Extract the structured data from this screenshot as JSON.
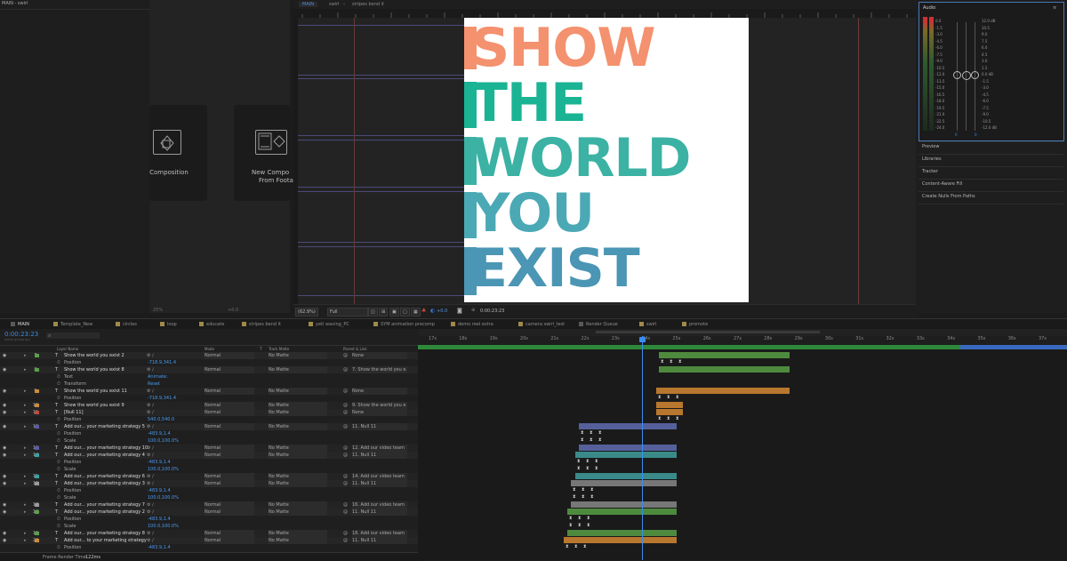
{
  "project": {
    "title": "MAIN - swirl"
  },
  "start_tiles": [
    {
      "label": "Composition"
    },
    {
      "label_line1": "New Compo",
      "label_line2": "From Foota"
    }
  ],
  "viewer": {
    "tabs": [
      "MAIN",
      "swirl",
      "stripes bend it"
    ],
    "words": [
      "SHOW",
      "THE",
      "WORLD",
      "YOU",
      "EXIST"
    ],
    "word_colors": [
      "#f4916e",
      "#1ab394",
      "#3bb2a4",
      "#4aa9b4",
      "#4a96b4"
    ],
    "zoom": "(62.9%)",
    "resolution": "Full",
    "exposure": "+0.0",
    "timecode": "0:00:23:23",
    "left_zoom": "25%",
    "left_exposure": "+0.0"
  },
  "right_panel": {
    "audio_title": "Audio",
    "db_left": [
      "0.0",
      "-1.5",
      "-3.0",
      "-4.5",
      "-6.0",
      "-7.5",
      "-9.0",
      "-10.5",
      "-12.0",
      "-13.5",
      "-15.0",
      "-16.5",
      "-18.0",
      "-19.5",
      "-21.0",
      "-22.5",
      "-24.0"
    ],
    "db_right": [
      "12.0 dB",
      "10.5",
      "9.0",
      "7.5",
      "6.0",
      "4.5",
      "3.0",
      "1.5",
      "0.0 dB",
      "-1.5",
      "-3.0",
      "-4.5",
      "-6.0",
      "-7.5",
      "-9.0",
      "-10.5",
      "-12.0 dB"
    ],
    "fader_values": [
      "0",
      "0"
    ],
    "items": [
      "Preview",
      "Libraries",
      "Tracker",
      "Content-Aware Fill",
      "Create Nulls From Paths"
    ]
  },
  "timeline": {
    "tabs": [
      "MAIN",
      "Template_New",
      "circles",
      "loop",
      "educate",
      "stripes bend it",
      "yeti waving_PC",
      "SYM animation precomp",
      "demo reel extra",
      "camera swirl_test",
      "Render Queue",
      "swirl",
      "promote"
    ],
    "timecode": "0:00:23:23",
    "timecode_sub": "00575 (23.976 fps)",
    "headers": {
      "layer_name": "Layer Name",
      "mode": "Mode",
      "t": "T",
      "track_matte": "Track Matte",
      "parent": "Parent & Link"
    },
    "ticks": [
      "17s",
      "18s",
      "19s",
      "20s",
      "21s",
      "22s",
      "23s",
      "24s",
      "25s",
      "26s",
      "27s",
      "28s",
      "29s",
      "30s",
      "31s",
      "32s",
      "33s",
      "34s",
      "35s",
      "36s",
      "37s"
    ],
    "layers": [
      {
        "num": "7",
        "name": "Show the world you exist 2",
        "mode": "Normal",
        "matte": "No Matte",
        "parent": "None",
        "color": "#5aa04a"
      },
      {
        "prop": "Position",
        "value": "-718.9,341.4"
      },
      {
        "num": "8",
        "name": "Show the world you exist 8",
        "mode": "Normal",
        "matte": "No Matte",
        "parent": "7. Show the world you e",
        "color": "#5aa04a"
      },
      {
        "prop": "Text",
        "value": "Animate:"
      },
      {
        "prop": "Transform",
        "value": "Reset"
      },
      {
        "num": "9",
        "name": "Show the world you exist 11",
        "mode": "Normal",
        "matte": "No Matte",
        "parent": "None",
        "color": "#d08a3a"
      },
      {
        "prop": "Position",
        "value": "-718.9,341.4"
      },
      {
        "num": "10",
        "name": "Show the world you exist 9",
        "mode": "Normal",
        "matte": "No Matte",
        "parent": "9. Show the world you e",
        "color": "#d08a3a"
      },
      {
        "num": "11",
        "name": "[Null 11]",
        "mode": "Normal",
        "matte": "No Matte",
        "parent": "None",
        "color": "#c04a3a"
      },
      {
        "prop": "Position",
        "value": "540.0,540.0"
      },
      {
        "num": "12",
        "name": "Add our... your marketing strategy 5",
        "mode": "Normal",
        "matte": "No Matte",
        "parent": "11. Null 11",
        "color": "#5a5aa8"
      },
      {
        "prop": "Position",
        "value": "-483.9,1.4"
      },
      {
        "prop": "Scale",
        "value": "100.0,100.0%"
      },
      {
        "num": "13",
        "name": "Add our... your marketing strategy 10",
        "mode": "Normal",
        "matte": "No Matte",
        "parent": "12. Add our video team",
        "color": "#5a5aa8"
      },
      {
        "num": "14",
        "name": "Add our... your marketing strategy 4",
        "mode": "Normal",
        "matte": "No Matte",
        "parent": "11. Null 11",
        "color": "#3aa0a0"
      },
      {
        "prop": "Position",
        "value": "-483.9,1.4"
      },
      {
        "prop": "Scale",
        "value": "100.0,100.0%"
      },
      {
        "num": "15",
        "name": "Add our... your marketing strategy 6",
        "mode": "Normal",
        "matte": "No Matte",
        "parent": "14. Add our video team",
        "color": "#3aa0a0"
      },
      {
        "num": "16",
        "name": "Add our... your marketing strategy 3",
        "mode": "Normal",
        "matte": "No Matte",
        "parent": "11. Null 11",
        "color": "#9a9a9a"
      },
      {
        "prop": "Position",
        "value": "-483.9,1.4"
      },
      {
        "prop": "Scale",
        "value": "100.0,100.0%"
      },
      {
        "num": "17",
        "name": "Add our... your marketing strategy 7",
        "mode": "Normal",
        "matte": "No Matte",
        "parent": "16. Add our video team",
        "color": "#9a9a9a"
      },
      {
        "num": "18",
        "name": "Add our... your marketing strategy 2",
        "mode": "Normal",
        "matte": "No Matte",
        "parent": "11. Null 11",
        "color": "#5aa04a"
      },
      {
        "prop": "Position",
        "value": "-483.9,1.4"
      },
      {
        "prop": "Scale",
        "value": "100.0,100.0%"
      },
      {
        "num": "19",
        "name": "Add our... your marketing strategy 8",
        "mode": "Normal",
        "matte": "No Matte",
        "parent": "18. Add our video team",
        "color": "#5aa04a"
      },
      {
        "num": "20",
        "name": "Add our... to your marketing strategy",
        "mode": "Normal",
        "matte": "No Matte",
        "parent": "11. Null 11",
        "color": "#d08a3a"
      },
      {
        "prop": "Position",
        "value": "-483.9,1.4"
      }
    ],
    "footer": {
      "label": "Frame Render Time",
      "value": "122ms"
    },
    "bar_colors": {
      "green": "#4e8a3e",
      "orange": "#b8772e",
      "slate": "#55609a",
      "teal": "#3a8a8a",
      "gray": "#777777"
    }
  }
}
